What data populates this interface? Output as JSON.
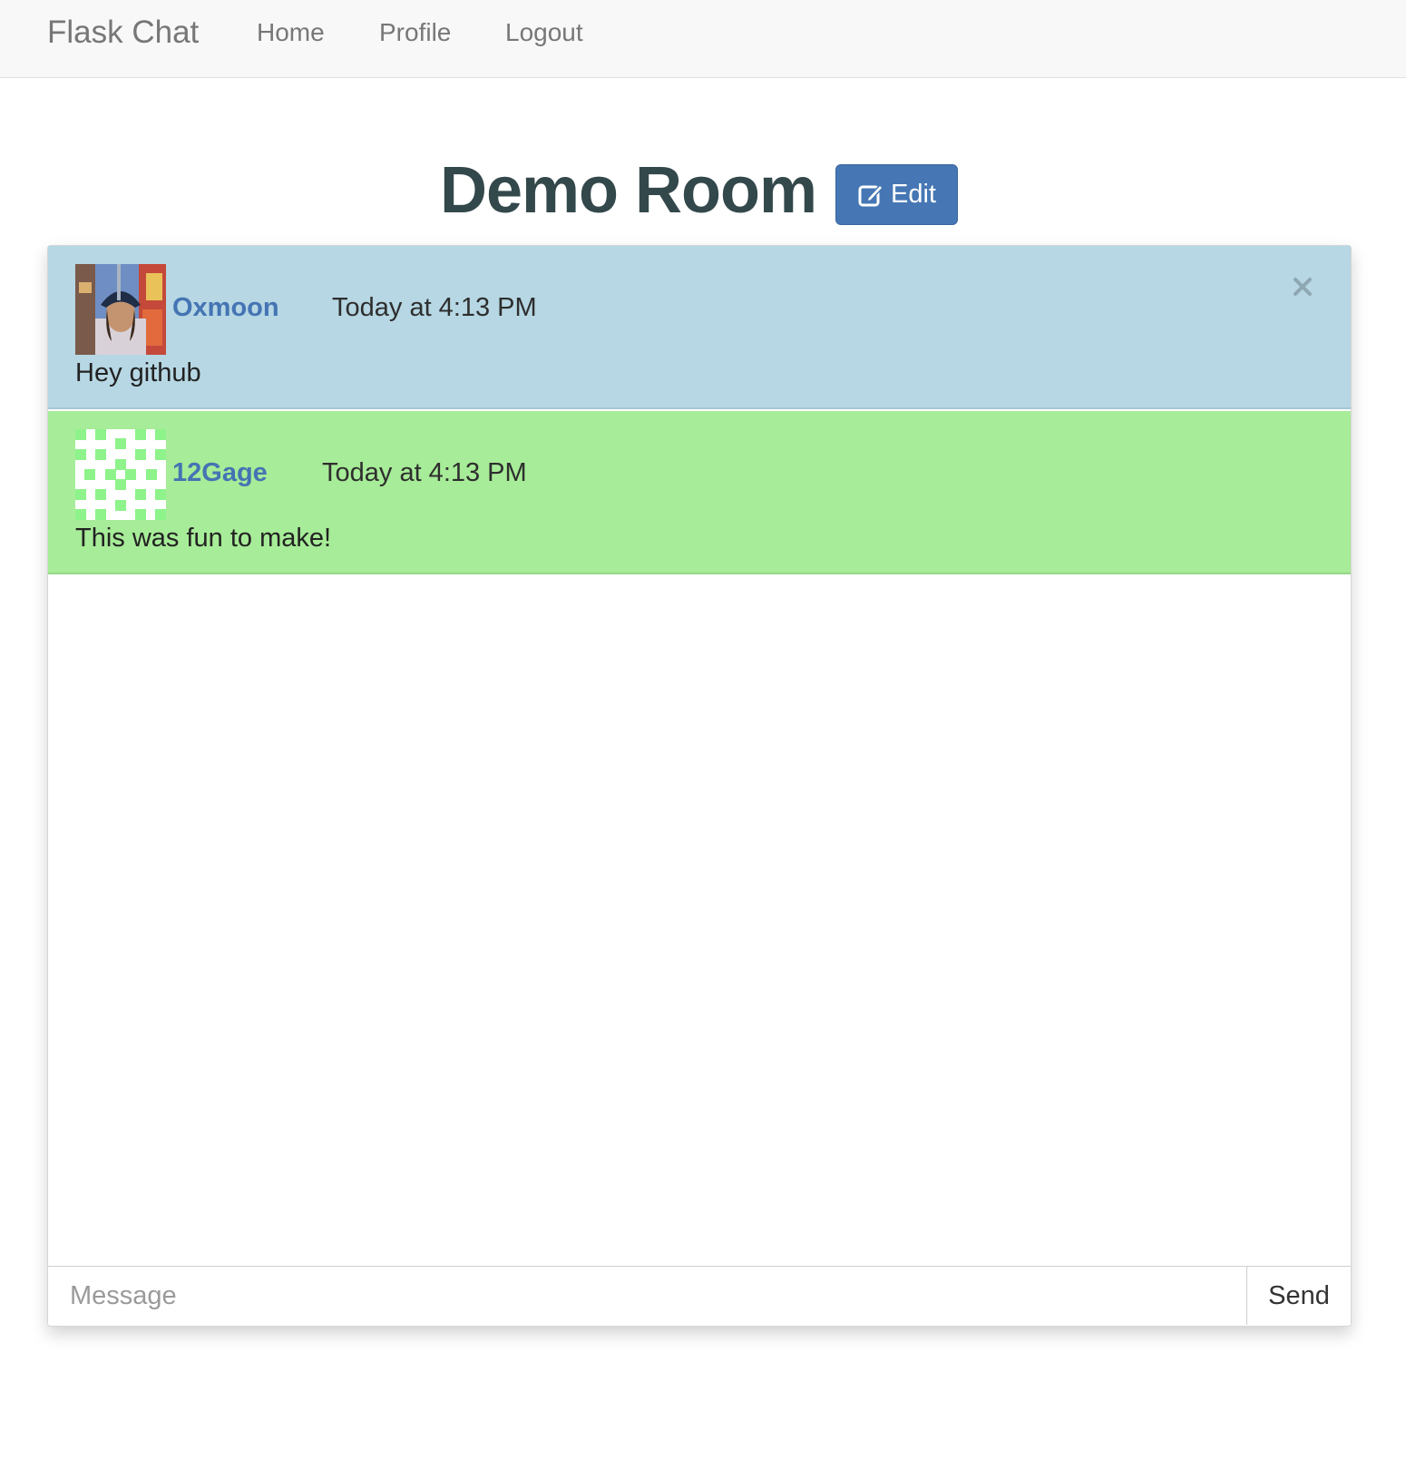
{
  "navbar": {
    "brand": "Flask Chat",
    "links": [
      "Home",
      "Profile",
      "Logout"
    ]
  },
  "room": {
    "title": "Demo Room",
    "edit_label": "Edit"
  },
  "messages": [
    {
      "username": "Oxmoon",
      "timestamp": "Today at 4:13 PM",
      "text": "Hey github",
      "background": "#b6d7e3",
      "deletable": true
    },
    {
      "username": "12Gage",
      "timestamp": "Today at 4:13 PM",
      "text": "This was fun to make!",
      "background": "#a7ec98",
      "deletable": false
    }
  ],
  "composer": {
    "placeholder": "Message",
    "send_label": "Send"
  },
  "colors": {
    "edit_button": "#4677b4",
    "username": "#4474b3",
    "title": "#33484b"
  },
  "icons": {
    "edit": "edit-icon",
    "close": "close-icon"
  }
}
